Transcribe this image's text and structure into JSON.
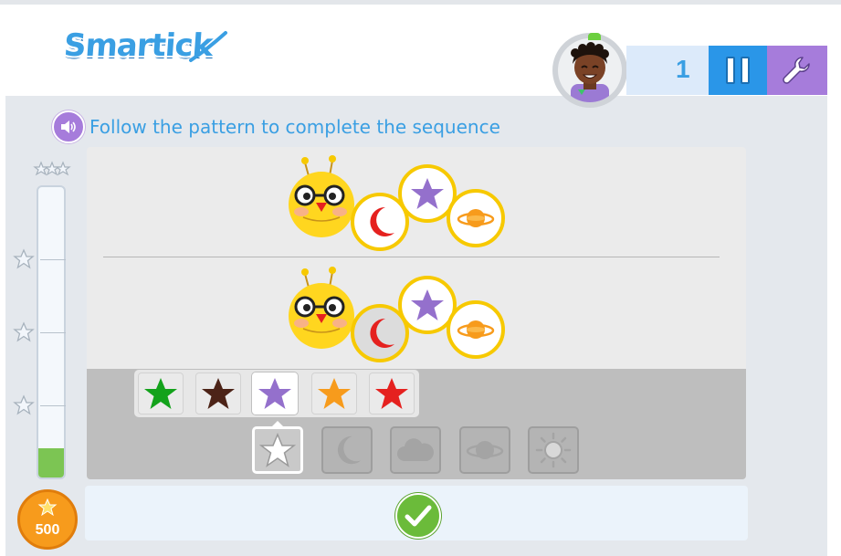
{
  "header": {
    "logo_text": "Smartick",
    "level_number": "1",
    "avatar": "child-avatar",
    "pause_icon": "pause-icon",
    "tools_icon": "wrench-icon"
  },
  "question": {
    "speaker_icon": "speaker-icon",
    "text": "Follow the pattern to complete the sequence"
  },
  "progress": {
    "fill_fraction": 0.1,
    "star_markers": 3
  },
  "score": {
    "icon": "star-icon",
    "value": "500"
  },
  "sequence": {
    "example": [
      "crescent-moon",
      "purple-star",
      "planet"
    ],
    "answer": [
      "crescent-moon",
      "purple-star",
      "planet"
    ]
  },
  "color_options": [
    {
      "name": "green",
      "hex": "#13a21b"
    },
    {
      "name": "brown",
      "hex": "#4c2317"
    },
    {
      "name": "purple",
      "hex": "#9470cc",
      "selected": true
    },
    {
      "name": "orange",
      "hex": "#f79b1c"
    },
    {
      "name": "red",
      "hex": "#e5211f"
    }
  ],
  "shape_options": [
    {
      "name": "star",
      "selected": true
    },
    {
      "name": "moon"
    },
    {
      "name": "cloud"
    },
    {
      "name": "planet"
    },
    {
      "name": "sun"
    }
  ],
  "submit": {
    "icon": "checkmark-icon"
  },
  "colors": {
    "accent_blue": "#3a9fe3",
    "pause_blue": "#2a96e8",
    "tools_purple": "#a67cdb",
    "progress_green": "#7cc553",
    "coin_orange": "#f79b1c",
    "bubble_yellow": "#f7c900",
    "check_green": "#6bbb3a"
  }
}
